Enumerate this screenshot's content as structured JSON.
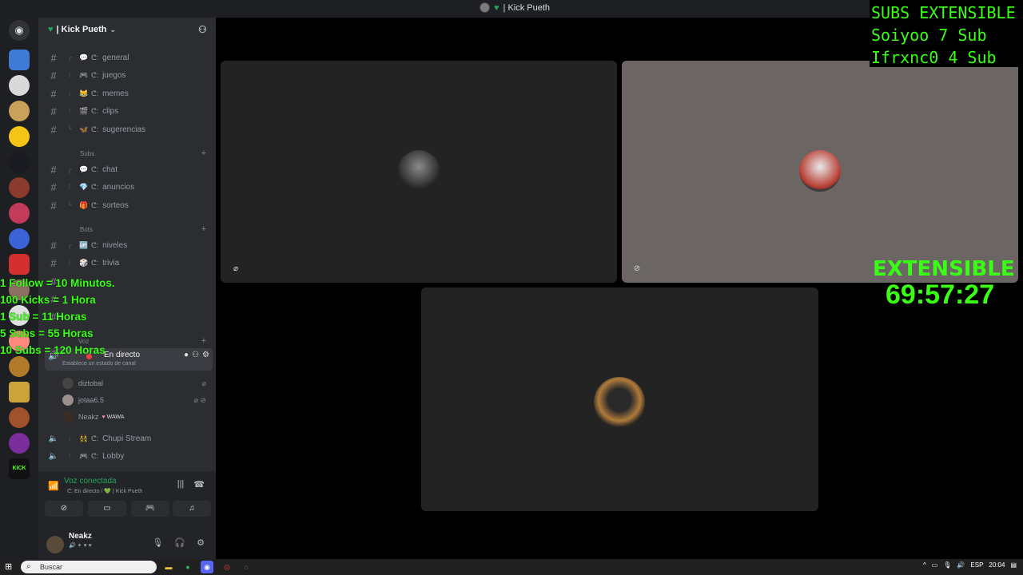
{
  "window": {
    "title": "| Kick Pueth"
  },
  "server": {
    "name": "| Kick Pueth"
  },
  "categories": {
    "subs": "Subs",
    "bots": "Bots",
    "voz": "Voz"
  },
  "channels": {
    "general": "general",
    "juegos": "juegos",
    "memes": "memes",
    "clips": "clips",
    "sugerencias": "sugerencias",
    "chat": "chat",
    "anuncios": "anuncios",
    "sorteos": "sorteos",
    "niveles": "niveles",
    "trivia": "trivia"
  },
  "channel_prefix": "ᕦ:",
  "live_channel": {
    "name": "En directo",
    "status": "Establece un estado de canal"
  },
  "voice_users": [
    {
      "name": "diztobal"
    },
    {
      "name": "jotaa6.5"
    },
    {
      "name": "Neakz",
      "tag": "WAWA"
    }
  ],
  "voice_channels": {
    "chupi": "Chupi Stream",
    "lobby": "Lobby"
  },
  "voice_panel": {
    "connected": "Voz conectada",
    "location": "ᕦ: En directo / 💚 | Kick Pueth"
  },
  "user": {
    "name": "Neakz"
  },
  "overlay": {
    "subs_title": "SUBS EXTENSIBLE",
    "subs": [
      "Soiyoo 7 Sub",
      "Ifrxnc0 4 Sub"
    ],
    "extensible_label": "EXTENSIBLE",
    "timer": "69:57:27",
    "rules": [
      "1 Follow = 10 Minutos.",
      "100 Kicks = 1 Hora",
      "1 Sub = 11 Horas",
      "5 Subs = 55 Horas",
      "10 Subs = 120 Horas"
    ]
  },
  "taskbar": {
    "search_placeholder": "Buscar",
    "lang": "ESP",
    "time": "20:04"
  },
  "colors": {
    "overlay_green": "#39ff14",
    "online": "#23a55a",
    "live_red": "#f23f43"
  }
}
